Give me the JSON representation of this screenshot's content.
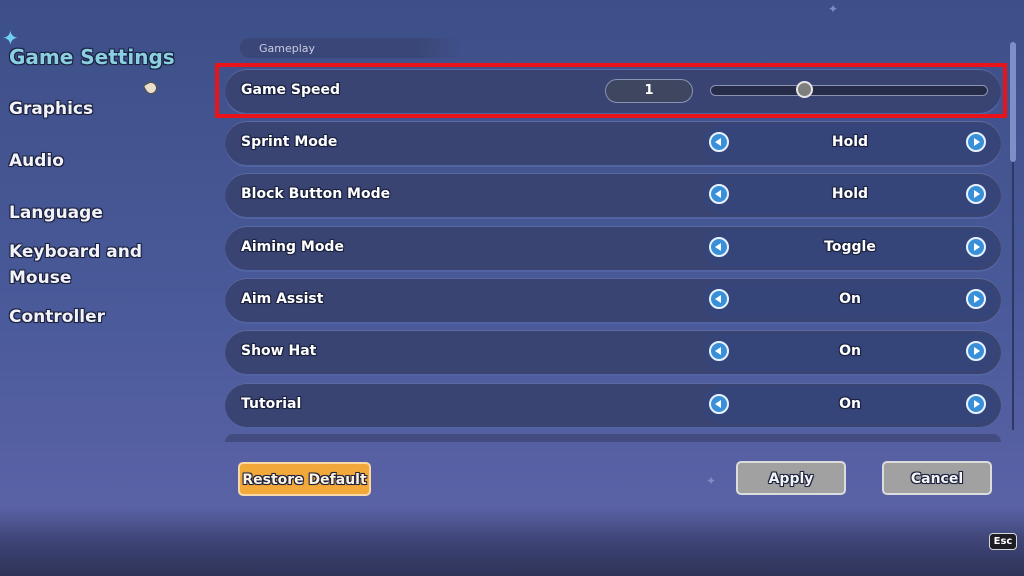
{
  "sidebar": {
    "title": "Game Settings",
    "items": [
      {
        "label": "Graphics"
      },
      {
        "label": "Audio"
      },
      {
        "label": "Language"
      },
      {
        "label": "Keyboard and\nMouse"
      },
      {
        "label": "Controller"
      }
    ]
  },
  "section": {
    "title": "Gameplay"
  },
  "settings": {
    "game_speed": {
      "label": "Game Speed",
      "value": "1",
      "slider_fraction": 0.34
    },
    "rows": [
      {
        "label": "Sprint Mode",
        "value": "Hold"
      },
      {
        "label": "Block Button Mode",
        "value": "Hold"
      },
      {
        "label": "Aiming Mode",
        "value": "Toggle"
      },
      {
        "label": "Aim Assist",
        "value": "On"
      },
      {
        "label": "Show Hat",
        "value": "On"
      },
      {
        "label": "Tutorial",
        "value": "On"
      }
    ]
  },
  "buttons": {
    "restore": "Restore Default",
    "apply": "Apply",
    "cancel": "Cancel",
    "esc": "Esc"
  },
  "colors": {
    "highlight": "#e8141a",
    "accent_title": "#8bd0e2",
    "arrow_blue": "#3a8fd9",
    "restore_orange": "#f3a93a"
  }
}
